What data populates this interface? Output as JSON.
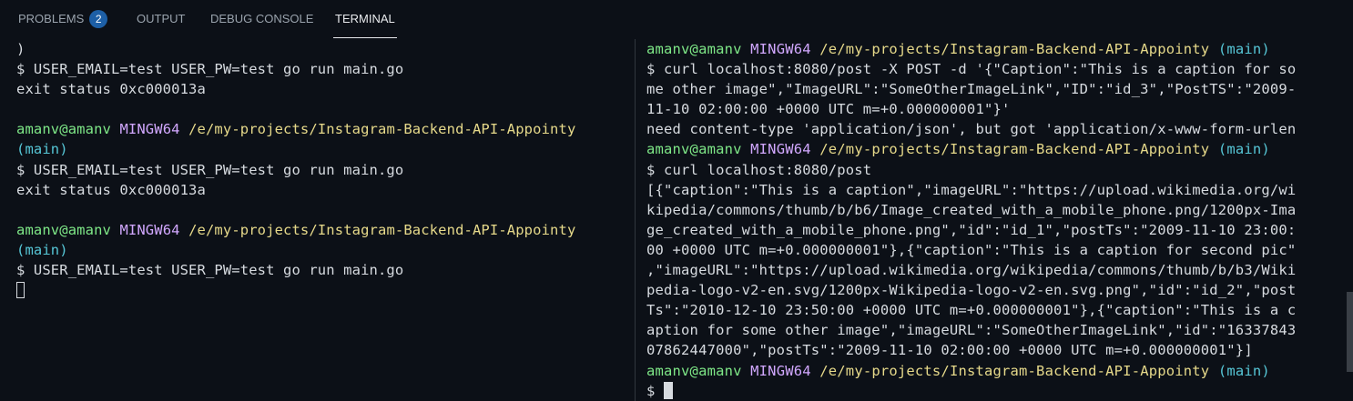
{
  "tabs": {
    "problems": "PROBLEMS",
    "problems_count": "2",
    "output": "OUTPUT",
    "debug_console": "DEBUG CONSOLE",
    "terminal": "TERMINAL"
  },
  "left": {
    "l0": ")",
    "l1": "$ USER_EMAIL=test USER_PW=test go run main.go",
    "l2": "exit status 0xc000013a",
    "p1_user": "amanv@amanv",
    "p1_host": "MINGW64",
    "p1_path": "/e/my-projects/Instagram-Backend-API-Appointy",
    "p1_branch": "(main)",
    "l5": "$ USER_EMAIL=test USER_PW=test go run main.go",
    "l6": "exit status 0xc000013a",
    "p2_user": "amanv@amanv",
    "p2_host": "MINGW64",
    "p2_path": "/e/my-projects/Instagram-Backend-API-Appointy",
    "p2_branch": "(main)",
    "l10": "$ USER_EMAIL=test USER_PW=test go run main.go"
  },
  "right": {
    "p1_user": "amanv@amanv",
    "p1_host": "MINGW64",
    "p1_path": "/e/my-projects/Instagram-Backend-API-Appointy",
    "p1_branch": "(main)",
    "l1": "$ curl localhost:8080/post -X POST -d '{\"Caption\":\"This is a caption for so",
    "l2": "me other image\",\"ImageURL\":\"SomeOtherImageLink\",\"ID\":\"id_3\",\"PostTS\":\"2009-",
    "l3": "11-10 02:00:00 +0000 UTC m=+0.000000001\"}'",
    "l4": "need content-type 'application/json', but got 'application/x-www-form-urlen",
    "p2_user": "amanv@amanv",
    "p2_host": "MINGW64",
    "p2_path": "/e/my-projects/Instagram-Backend-API-Appointy",
    "p2_branch": "(main)",
    "l6": "$ curl localhost:8080/post",
    "l7": "[{\"caption\":\"This is a caption\",\"imageURL\":\"https://upload.wikimedia.org/wi",
    "l8": "kipedia/commons/thumb/b/b6/Image_created_with_a_mobile_phone.png/1200px-Ima",
    "l9": "ge_created_with_a_mobile_phone.png\",\"id\":\"id_1\",\"postTs\":\"2009-11-10 23:00:",
    "l10": "00 +0000 UTC m=+0.000000001\"},{\"caption\":\"This is a caption for second pic\"",
    "l11": ",\"imageURL\":\"https://upload.wikimedia.org/wikipedia/commons/thumb/b/b3/Wiki",
    "l12": "pedia-logo-v2-en.svg/1200px-Wikipedia-logo-v2-en.svg.png\",\"id\":\"id_2\",\"post",
    "l13": "Ts\":\"2010-12-10 23:50:00 +0000 UTC m=+0.000000001\"},{\"caption\":\"This is a c",
    "l14": "aption for some other image\",\"imageURL\":\"SomeOtherImageLink\",\"id\":\"16337843",
    "l15": "07862447000\",\"postTs\":\"2009-11-10 02:00:00 +0000 UTC m=+0.000000001\"}]",
    "p3_user": "amanv@amanv",
    "p3_host": "MINGW64",
    "p3_path": "/e/my-projects/Instagram-Backend-API-Appointy",
    "p3_branch": "(main)",
    "l17": "$"
  },
  "colors": {
    "background": "#0c1017",
    "user": "#7ee787",
    "host": "#d2a8ff",
    "path": "#e6d98a",
    "branch": "#56c6d6",
    "badge": "#1d5fa6"
  }
}
